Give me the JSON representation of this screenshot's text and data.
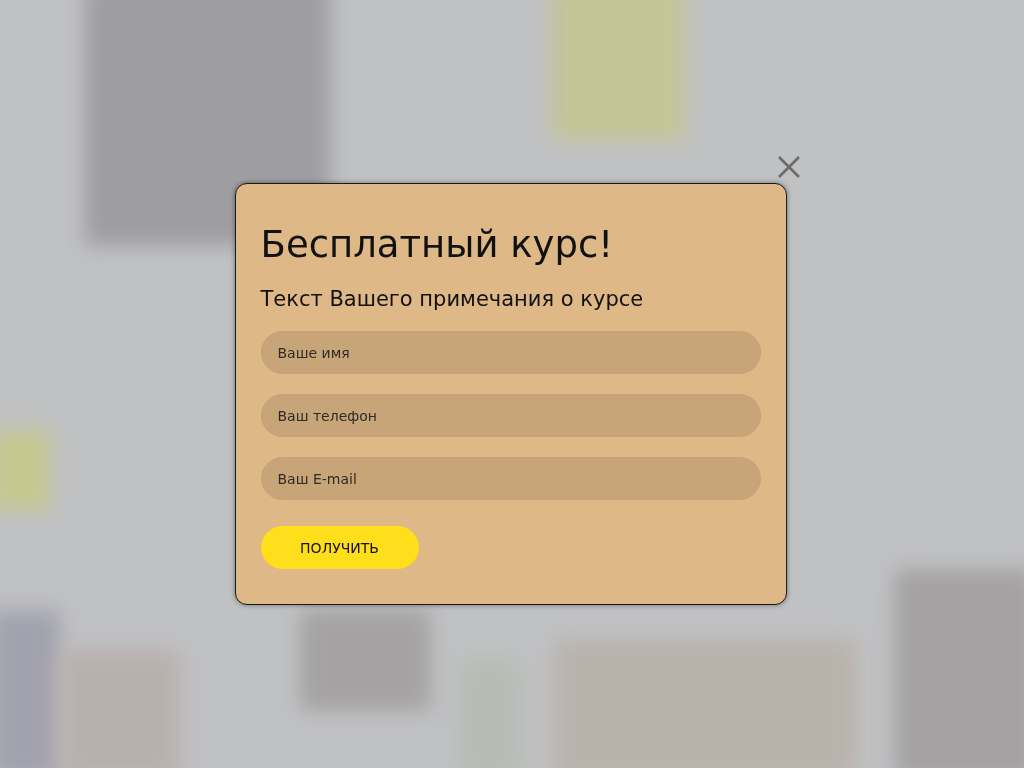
{
  "modal": {
    "title": "Бесплатный курс!",
    "subtitle": "Текст Вашего примечания о курсе",
    "fields": [
      {
        "placeholder": "Ваше имя"
      },
      {
        "placeholder": "Ваш телефон"
      },
      {
        "placeholder": "Ваш E-mail"
      }
    ],
    "submit_button": "ПОЛУЧИТЬ"
  }
}
